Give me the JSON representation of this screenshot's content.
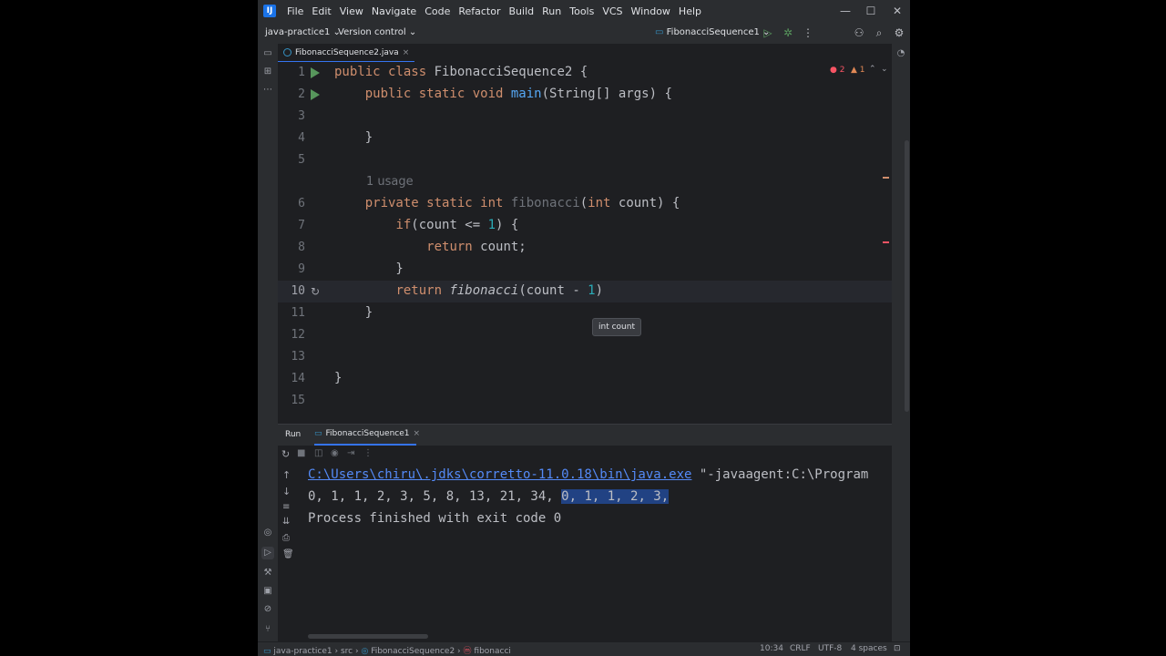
{
  "menu": {
    "items": [
      "File",
      "Edit",
      "View",
      "Navigate",
      "Code",
      "Refactor",
      "Build",
      "Run",
      "Tools",
      "VCS",
      "Window",
      "Help"
    ]
  },
  "toolbar": {
    "project": "java-practice1",
    "vcs": "Version control",
    "run_config": "FibonacciSequence1"
  },
  "editor": {
    "tab_label": "FibonacciSequence2.java",
    "error_count": "2",
    "warning_count": "1",
    "usage_hint": "1 usage",
    "param_hint": "int count",
    "line_numbers": [
      "1",
      "2",
      "3",
      "4",
      "5",
      "6",
      "7",
      "8",
      "9",
      "10",
      "11",
      "12",
      "13",
      "14",
      "15"
    ]
  },
  "run_panel": {
    "title": "Run",
    "tab": "FibonacciSequence1",
    "console": {
      "cmd_path": "C:\\Users\\chiru\\.jdks\\corretto-11.0.18\\bin\\java.exe",
      "cmd_rest": " \"-javaagent:C:\\Program",
      "output_plain": "0, 1, 1, 2, 3, 5, 8, 13, 21, 34, ",
      "output_selected": "0, 1, 1, 2, 3,",
      "exit_message": "Process finished with exit code 0"
    }
  },
  "statusbar": {
    "breadcrumb": [
      "java-practice1",
      "src",
      "FibonacciSequence2",
      "fibonacci"
    ],
    "position": "10:34",
    "line_sep": "CRLF",
    "encoding": "UTF-8",
    "indent": "4 spaces"
  },
  "colors": {
    "background": "#1e1f22",
    "panel": "#2b2d30",
    "keyword": "#cf8e6d",
    "method": "#56a8f5",
    "number": "#2aacb8",
    "link": "#548af7",
    "selection": "#214283",
    "run_green": "#57965c"
  }
}
